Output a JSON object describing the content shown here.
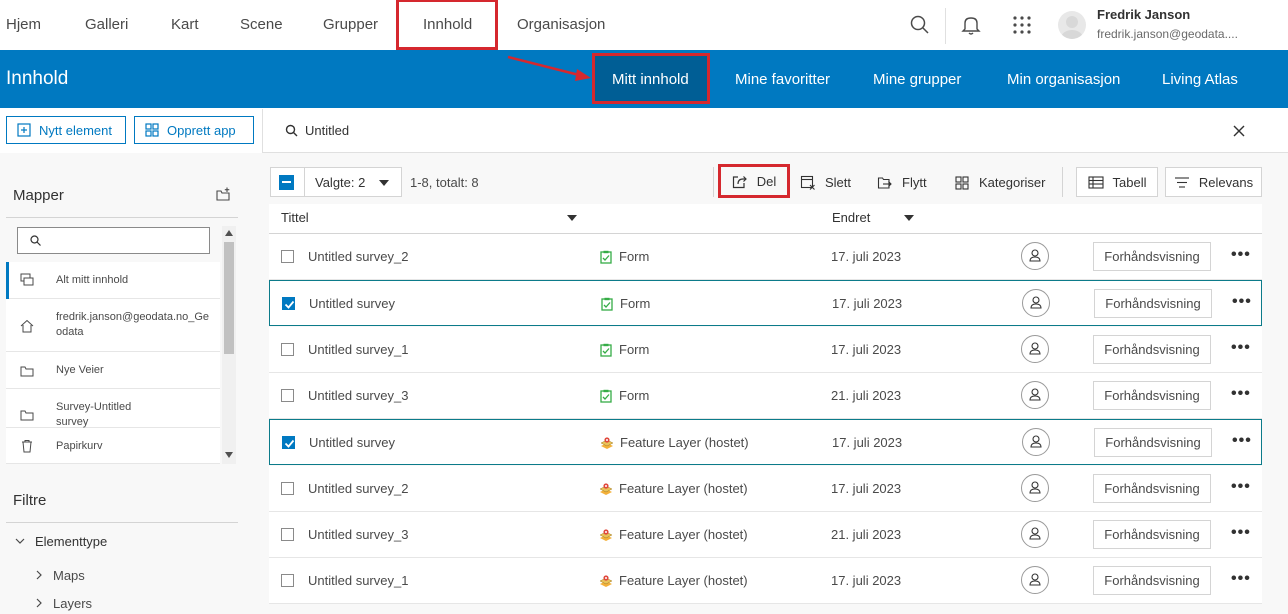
{
  "topnav": {
    "items": [
      "Hjem",
      "Galleri",
      "Kart",
      "Scene",
      "Grupper",
      "Innhold",
      "Organisasjon"
    ],
    "user_name": "Fredrik Janson",
    "user_email": "fredrik.janson@geodata....",
    "icons": [
      "search-icon",
      "bell-icon",
      "app-launcher-icon"
    ]
  },
  "bluebar": {
    "title": "Innhold",
    "tabs": [
      "Mitt innhold",
      "Mine favoritter",
      "Mine grupper",
      "Min organisasjon",
      "Living Atlas"
    ]
  },
  "actions": {
    "new_item": "Nytt element",
    "create_app": "Opprett app"
  },
  "search": {
    "value": "Untitled"
  },
  "toolbar": {
    "selected": "Valgte: 2",
    "count": "1-8, totalt: 8",
    "share": "Del",
    "delete": "Slett",
    "move": "Flytt",
    "categorize": "Kategoriser",
    "view": "Tabell",
    "sort": "Relevans"
  },
  "columns": {
    "title": "Tittel",
    "modified": "Endret"
  },
  "sidebar": {
    "folders_heading": "Mapper",
    "folders": [
      "Alt mitt innhold",
      "fredrik.janson@geodata.no_Geodata",
      "Nye Veier",
      "Survey-Untitled survey",
      "Papirkurv"
    ],
    "filters_heading": "Filtre",
    "filter_group": "Elementtype",
    "filter_items": [
      "Maps",
      "Layers"
    ]
  },
  "rows": [
    {
      "title": "Untitled survey_2",
      "type": "Form",
      "date": "17. juli 2023",
      "checked": false
    },
    {
      "title": "Untitled survey",
      "type": "Form",
      "date": "17. juli 2023",
      "checked": true
    },
    {
      "title": "Untitled survey_1",
      "type": "Form",
      "date": "17. juli 2023",
      "checked": false
    },
    {
      "title": "Untitled survey_3",
      "type": "Form",
      "date": "21. juli 2023",
      "checked": false
    },
    {
      "title": "Untitled survey",
      "type": "Feature Layer (hostet)",
      "date": "17. juli 2023",
      "checked": true
    },
    {
      "title": "Untitled survey_2",
      "type": "Feature Layer (hostet)",
      "date": "17. juli 2023",
      "checked": false
    },
    {
      "title": "Untitled survey_3",
      "type": "Feature Layer (hostet)",
      "date": "21. juli 2023",
      "checked": false
    },
    {
      "title": "Untitled survey_1",
      "type": "Feature Layer (hostet)",
      "date": "17. juli 2023",
      "checked": false
    }
  ],
  "preview_label": "Forhåndsvisning",
  "colors": {
    "brand_blue": "#0079c1",
    "active_tab": "#005e95",
    "highlight_red": "#d5282e",
    "form_green": "#35ac46",
    "layer_yellow": "#f3b03a"
  }
}
